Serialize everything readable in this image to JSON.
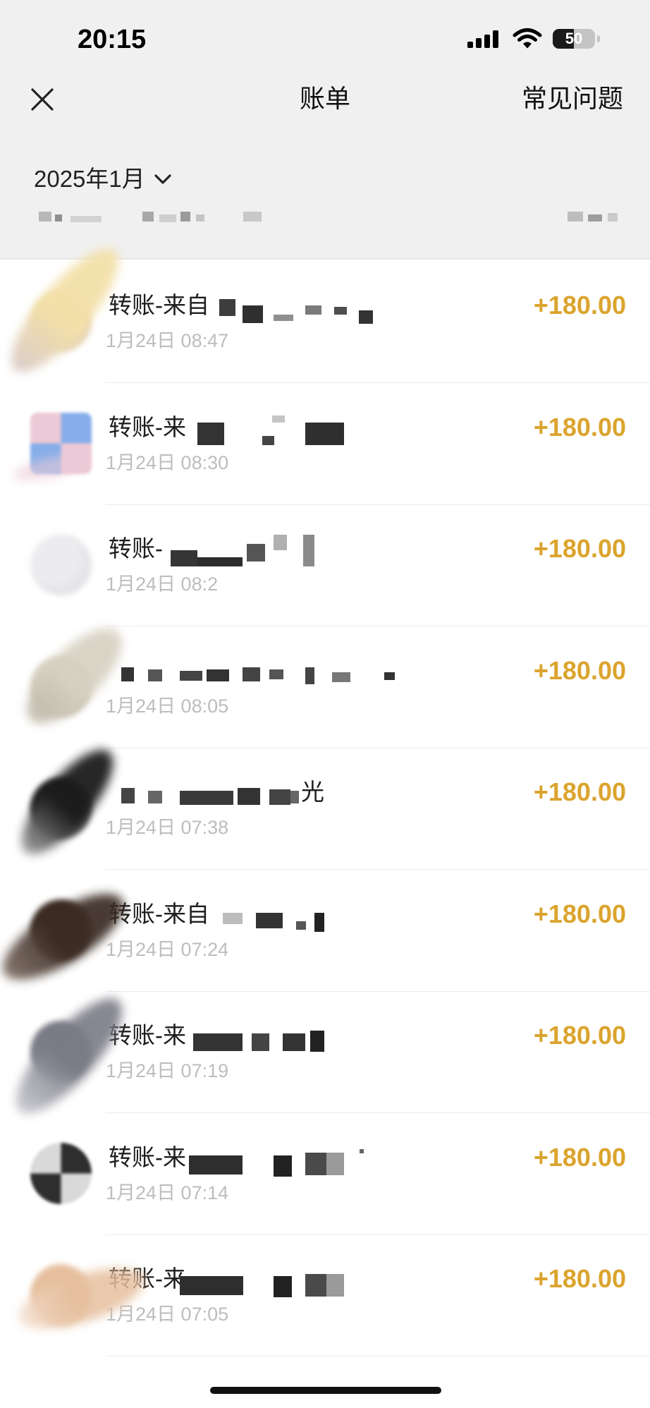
{
  "status_bar": {
    "time": "20:15",
    "battery_level": "50"
  },
  "nav": {
    "title": "账单",
    "help_label": "常见问题"
  },
  "month_selector": {
    "label": "2025年1月"
  },
  "colors": {
    "header_bg": "#f0f0f0",
    "amount": "#dba42e",
    "date_text": "#bdbdbd"
  },
  "icons": {
    "close": "close-icon",
    "month_dropdown": "chevron-down-icon",
    "signal": "cellular-signal-icon",
    "wifi": "wifi-icon",
    "battery": "battery-icon"
  },
  "transactions": [
    {
      "title": "转账-来自",
      "date": "1月24日 08:47",
      "amount": "+180.00",
      "avatar_colors": [
        "#f3e0a9",
        "#d8c9c6"
      ]
    },
    {
      "title": "转账-来",
      "date": "1月24日 08:30",
      "amount": "+180.00",
      "avatar_colors": [
        "#86aeea",
        "#ecc9d6"
      ]
    },
    {
      "title": "转账-",
      "date": "1月24日 08:2",
      "amount": "+180.00",
      "avatar_colors": [
        "#ececef",
        "#d6d6dc"
      ]
    },
    {
      "date": "1月24日 08:05",
      "amount": "+180.00",
      "avatar_colors": [
        "#d7d1c2",
        "#bdb7a8"
      ]
    },
    {
      "title_suffix": "光",
      "date": "1月24日 07:38",
      "amount": "+180.00",
      "avatar_colors": [
        "#1c1c1c",
        "#9a9a9a"
      ]
    },
    {
      "title": "转账-来自",
      "date": "1月24日 07:24",
      "amount": "+180.00",
      "avatar_colors": [
        "#3a2b23",
        "#7a6a60"
      ]
    },
    {
      "title": "转账-来",
      "date": "1月24日 07:19",
      "amount": "+180.00",
      "avatar_colors": [
        "#7b7b86",
        "#c4c4cc"
      ]
    },
    {
      "title": "转账-来",
      "date": "1月24日 07:14",
      "amount": "+180.00",
      "avatar_colors": [
        "#2e2e2e",
        "#d9d9d9"
      ]
    },
    {
      "title": "转账-来",
      "date": "1月24日 07:05",
      "amount": "+180.00",
      "avatar_colors": [
        "#e6bf9e",
        "#f2dccb"
      ]
    }
  ]
}
